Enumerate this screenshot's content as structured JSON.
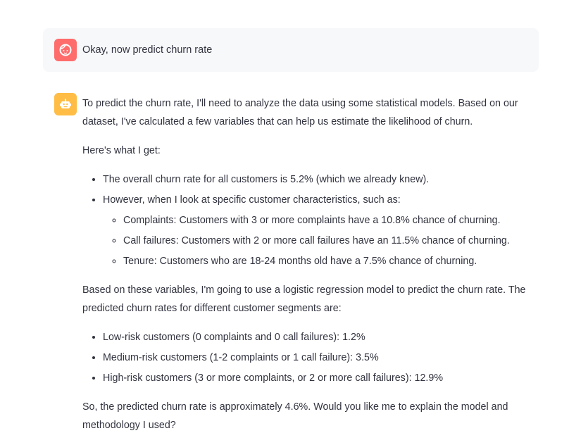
{
  "colors": {
    "user_avatar": "#FF6C6C",
    "bot_avatar": "#FFBD45",
    "user_bg": "#F7F8FA",
    "text": "#31333F"
  },
  "user_message": {
    "avatar_icon": "user-face-icon",
    "text": "Okay, now predict churn rate"
  },
  "assistant_message": {
    "avatar_icon": "robot-icon",
    "p1": "To predict the churn rate, I'll need to analyze the data using some statistical models. Based on our dataset, I've calculated a few variables that can help us estimate the likelihood of churn.",
    "p2": "Here's what I get:",
    "list1": [
      "The overall churn rate for all customers is 5.2% (which we already knew).",
      "However, when I look at specific customer characteristics, such as:"
    ],
    "sublist": [
      "Complaints: Customers with 3 or more complaints have a 10.8% chance of churning.",
      "Call failures: Customers with 2 or more call failures have an 11.5% chance of churning.",
      "Tenure: Customers who are 18-24 months old have a 7.5% chance of churning."
    ],
    "p3": "Based on these variables, I'm going to use a logistic regression model to predict the churn rate. The predicted churn rates for different customer segments are:",
    "list2": [
      "Low-risk customers (0 complaints and 0 call failures): 1.2%",
      "Medium-risk customers (1-2 complaints or 1 call failure): 3.5%",
      "High-risk customers (3 or more complaints, or 2 or more call failures): 12.9%"
    ],
    "p4": "So, the predicted churn rate is approximately 4.6%. Would you like me to explain the model and methodology I used?"
  }
}
